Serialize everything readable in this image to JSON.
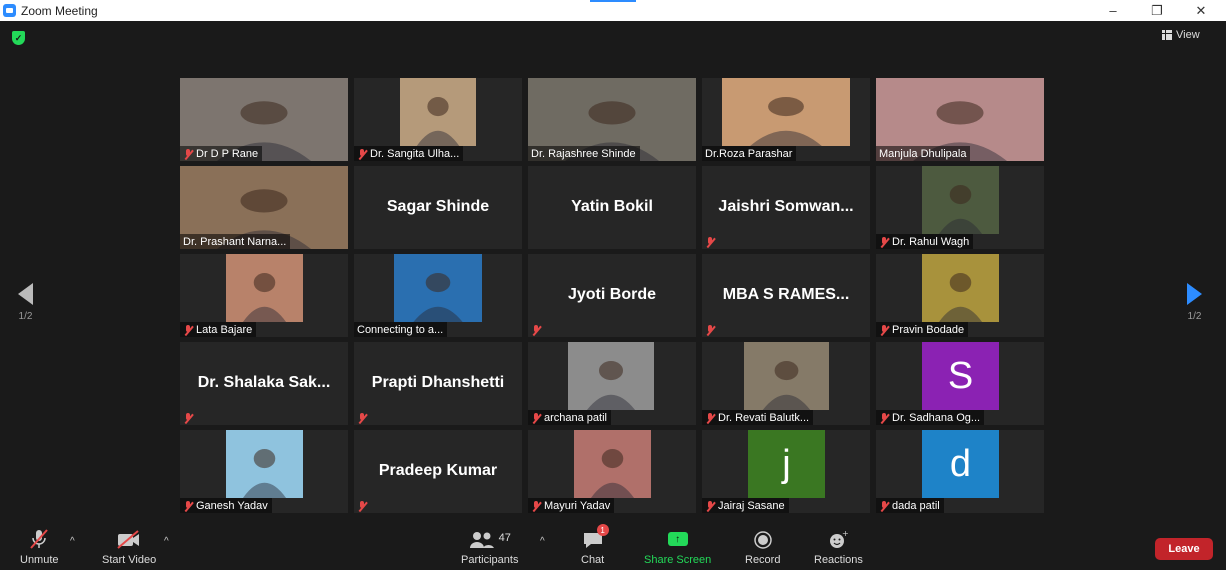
{
  "window": {
    "title": "Zoom Meeting",
    "minimize": "–",
    "restore": "❐",
    "close": "✕"
  },
  "header": {
    "view_label": "View"
  },
  "nav": {
    "prev_page": "1/2",
    "next_page": "1/2"
  },
  "tiles": [
    {
      "name": "Dr D P Rane",
      "muted": true,
      "kind": "video",
      "bg": "#7d756f",
      "active": false
    },
    {
      "name": "Dr. Sangita Ulha...",
      "muted": true,
      "kind": "video",
      "bg": "#b59a7a",
      "active": false
    },
    {
      "name": "Dr. Rajashree Shinde",
      "muted": false,
      "kind": "video",
      "bg": "#6f6b62",
      "active": true
    },
    {
      "name": "Dr.Roza Parashar",
      "muted": false,
      "kind": "video",
      "bg": "#c89a72",
      "active": false
    },
    {
      "name": "Manjula Dhulipala",
      "muted": false,
      "kind": "video",
      "bg": "#b68a8a",
      "active": false
    },
    {
      "name": "Dr. Prashant Narna...",
      "muted": false,
      "kind": "video",
      "bg": "#8a7058",
      "active": false
    },
    {
      "name": "Sagar Shinde",
      "muted": false,
      "kind": "name",
      "bg": "",
      "active": false
    },
    {
      "name": "Yatin Bokil",
      "muted": false,
      "kind": "name",
      "bg": "",
      "active": false
    },
    {
      "name": "Jaishri  Somwan...",
      "muted": true,
      "kind": "name",
      "bg": "",
      "active": false
    },
    {
      "name": "Dr. Rahul Wagh",
      "muted": true,
      "kind": "video",
      "bg": "#4d5a3f",
      "active": false
    },
    {
      "name": "Lata Bajare",
      "muted": true,
      "kind": "video",
      "bg": "#b8826a",
      "active": false
    },
    {
      "name": "Connecting to a...",
      "muted": false,
      "kind": "video",
      "bg": "#2a6fb0",
      "active": false
    },
    {
      "name": "Jyoti Borde",
      "muted": true,
      "kind": "name",
      "bg": "",
      "active": false
    },
    {
      "name": "MBA S RAMES...",
      "muted": true,
      "kind": "name",
      "bg": "",
      "active": false
    },
    {
      "name": "Pravin Bodade",
      "muted": true,
      "kind": "video",
      "bg": "#a8923c",
      "active": false
    },
    {
      "name": "Dr. Shalaka Sak...",
      "muted": true,
      "kind": "name",
      "bg": "",
      "active": false
    },
    {
      "name": "Prapti Dhanshetti",
      "muted": true,
      "kind": "name",
      "bg": "",
      "active": false
    },
    {
      "name": "archana patil",
      "muted": true,
      "kind": "video",
      "bg": "#8c8c8c",
      "active": false
    },
    {
      "name": "Dr. Revati Balutk...",
      "muted": true,
      "kind": "video",
      "bg": "#857a68",
      "active": false
    },
    {
      "name": "Dr. Sadhana Og...",
      "muted": true,
      "kind": "avatar",
      "letter": "S",
      "bg": "#8b22b3",
      "active": false
    },
    {
      "name": "Ganesh Yadav",
      "muted": true,
      "kind": "video",
      "bg": "#8fc3de",
      "active": false
    },
    {
      "name": "Pradeep Kumar",
      "muted": true,
      "kind": "name",
      "bg": "",
      "active": false
    },
    {
      "name": "Mayuri Yadav",
      "muted": true,
      "kind": "video",
      "bg": "#b0706a",
      "active": false
    },
    {
      "name": "Jairaj Sasane",
      "muted": true,
      "kind": "avatar",
      "letter": "j",
      "bg": "#3a7722",
      "active": false
    },
    {
      "name": "dada patil",
      "muted": true,
      "kind": "avatar",
      "letter": "d",
      "bg": "#1e83c8",
      "active": false
    }
  ],
  "toolbar": {
    "unmute": "Unmute",
    "start_video": "Start Video",
    "participants_count": "47",
    "participants": "Participants",
    "chat": "Chat",
    "chat_badge": "1",
    "share_screen": "Share Screen",
    "record": "Record",
    "reactions": "Reactions",
    "leave": "Leave"
  },
  "colors": {
    "accent_blue": "#2d8cff",
    "share_green": "#23d959",
    "leave_red": "#c2242a",
    "active_border": "#9ad13f",
    "muted_red": "#e54848"
  }
}
